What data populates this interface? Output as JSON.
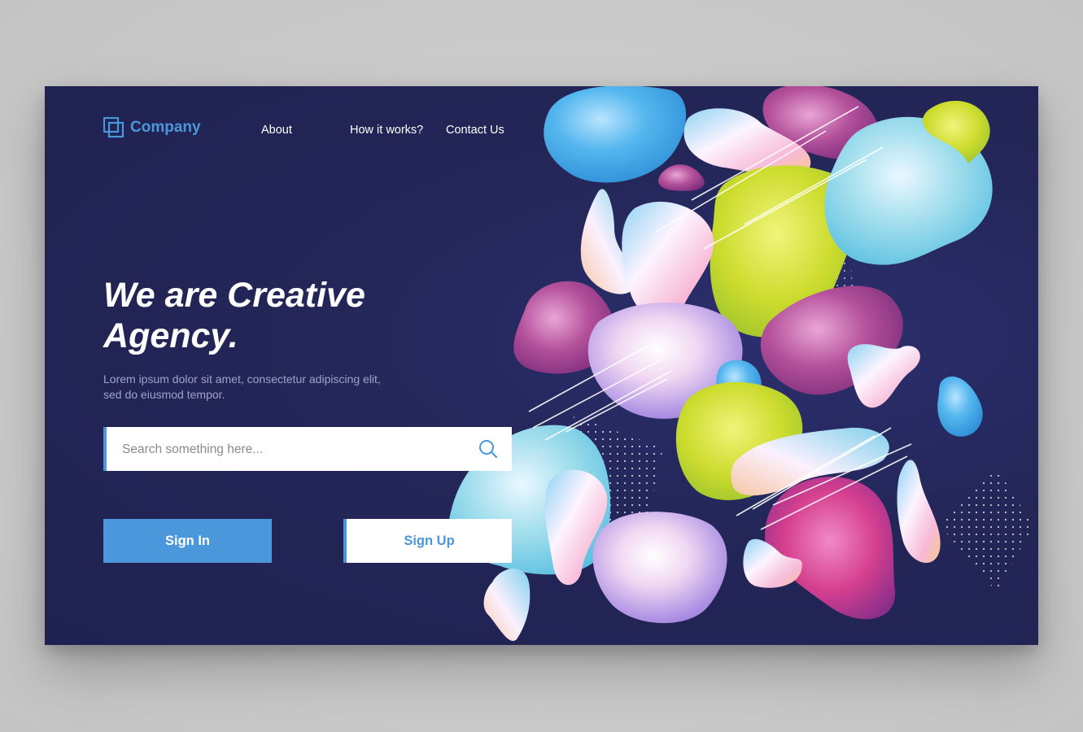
{
  "brand": {
    "name": "Company",
    "logo_icon": "overlapping-squares-icon",
    "accent": "#4a97dc"
  },
  "nav": {
    "items": [
      {
        "label": "About"
      },
      {
        "label": "How it works?"
      },
      {
        "label": "Contact Us"
      }
    ]
  },
  "hero": {
    "title_line1": "We are Creative",
    "title_line2": "Agency.",
    "description_line1": "Lorem ipsum dolor sit amet, consectetur adipiscing elit,",
    "description_line2": "sed do eiusmod tempor."
  },
  "search": {
    "placeholder": "Search something here...",
    "value": "",
    "icon": "search-icon"
  },
  "actions": {
    "sign_in": "Sign In",
    "sign_up": "Sign Up"
  },
  "colors": {
    "background": "#23265a",
    "accent": "#4a97dc",
    "text": "#ffffff"
  }
}
